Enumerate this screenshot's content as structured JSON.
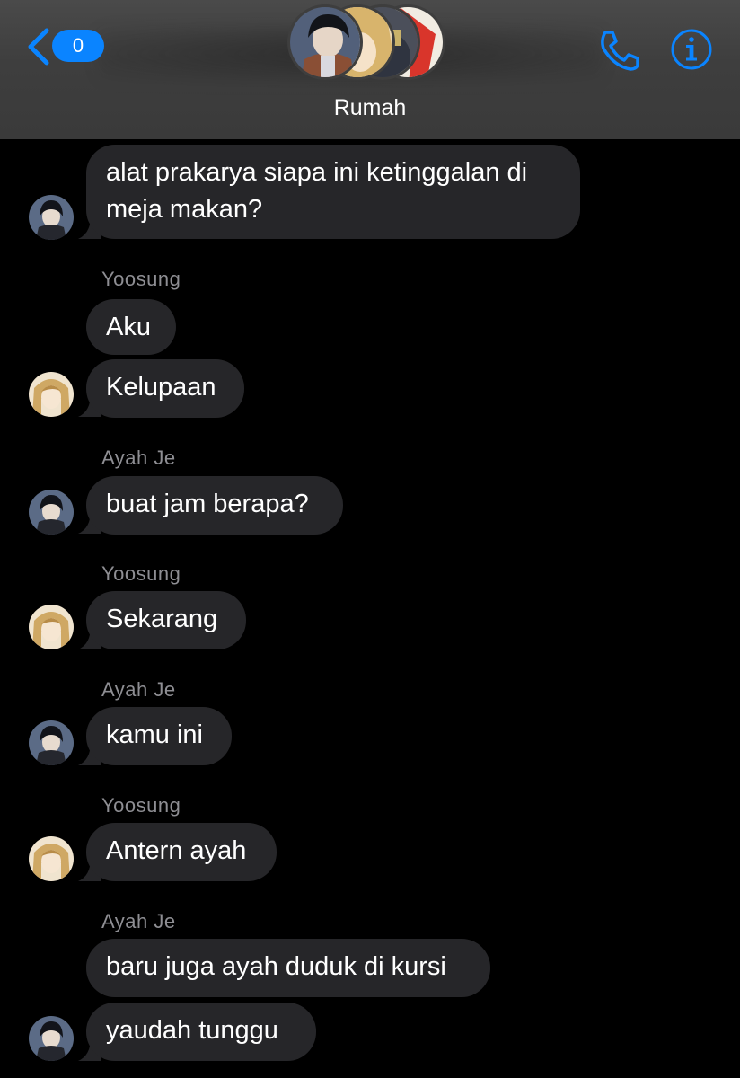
{
  "header": {
    "back_count": "0",
    "group_name": "Rumah"
  },
  "messages": [
    {
      "text": "alat prakarya siapa ini ketinggalan di meja makan?"
    },
    {
      "sender": "Yoosung",
      "text": "Aku"
    },
    {
      "text": "Kelupaan"
    },
    {
      "sender": "Ayah Je",
      "text": "buat jam berapa?"
    },
    {
      "sender": "Yoosung",
      "text": "Sekarang"
    },
    {
      "sender": "Ayah Je",
      "text": "kamu ini"
    },
    {
      "sender": "Yoosung",
      "text": "Antern ayah"
    },
    {
      "sender": "Ayah Je",
      "text": "baru juga ayah duduk di kursi"
    },
    {
      "text": "yaudah tunggu"
    }
  ],
  "colors": {
    "accent": "#0a84ff",
    "bubble": "#262629",
    "header": "#3e3e3e",
    "sender_label": "#8e8e93"
  },
  "icons": [
    "chevron-left-icon",
    "phone-icon",
    "info-icon"
  ]
}
